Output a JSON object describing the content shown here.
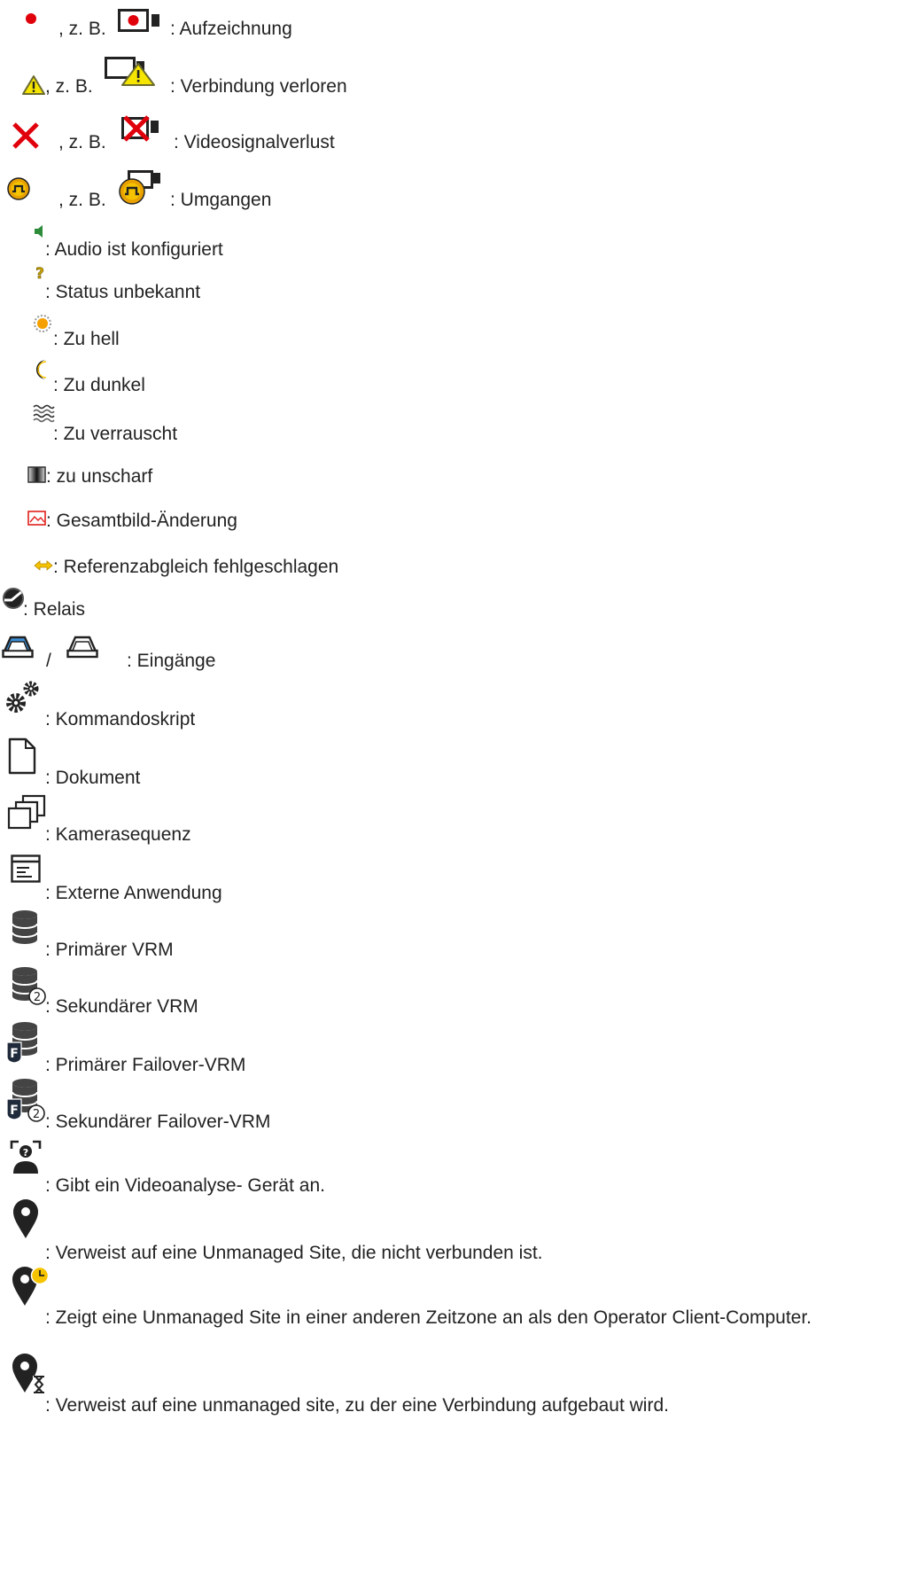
{
  "legend": {
    "eg": ", z. B.",
    "items": [
      {
        "label": ": Aufzeichnung",
        "icon": "recording-dot-icon",
        "example_icon": "camera-recording-icon"
      },
      {
        "label": ": Verbindung verloren",
        "icon": "warning-triangle-icon",
        "example_icon": "camera-connection-lost-icon"
      },
      {
        "label": ": Videosignalverlust",
        "icon": "red-x-icon",
        "example_icon": "camera-video-loss-icon"
      },
      {
        "label": ": Umgangen",
        "icon": "bypass-icon",
        "example_icon": "camera-bypassed-icon"
      },
      {
        "label": ": Audio ist konfiguriert",
        "icon": "speaker-icon"
      },
      {
        "label": ": Status unbekannt",
        "icon": "question-mark-icon"
      },
      {
        "label": ": Zu hell",
        "icon": "sun-icon"
      },
      {
        "label": ": Zu dunkel",
        "icon": "moon-icon"
      },
      {
        "label": ": Zu verrauscht",
        "icon": "noise-icon"
      },
      {
        "label": ": zu unscharf",
        "icon": "blur-icon"
      },
      {
        "label": ": Gesamtbild-Änderung",
        "icon": "scene-change-icon"
      },
      {
        "label": ": Referenzabgleich fehlgeschlagen",
        "icon": "reference-check-icon"
      },
      {
        "label": ": Relais",
        "icon": "relay-icon"
      },
      {
        "label": ": Eingänge",
        "icon": "input-active-icon",
        "separator": "/",
        "icon2": "input-inactive-icon"
      },
      {
        "label": ": Kommandoskript",
        "icon": "gears-icon"
      },
      {
        "label": ": Dokument",
        "icon": "document-icon"
      },
      {
        "label": ": Kamerasequenz",
        "icon": "camera-sequence-icon"
      },
      {
        "label": ": Externe Anwendung",
        "icon": "external-application-icon"
      },
      {
        "label": ": Primärer VRM",
        "icon": "primary-vrm-icon"
      },
      {
        "label": ": Sekundärer VRM",
        "icon": "secondary-vrm-icon"
      },
      {
        "label": ": Primärer Failover-VRM",
        "icon": "primary-failover-vrm-icon"
      },
      {
        "label": ": Sekundärer Failover-VRM",
        "icon": "secondary-failover-vrm-icon"
      },
      {
        "label": ": Gibt ein Videoanalyse- Gerät an.",
        "icon": "video-analytics-icon"
      },
      {
        "label": ": Verweist auf eine Unmanaged Site, die nicht verbunden ist.",
        "icon": "map-pin-icon"
      },
      {
        "label": ": Zeigt eine Unmanaged Site in einer anderen Zeitzone an als den Operator Client-Computer.",
        "icon": "map-pin-clock-icon"
      },
      {
        "label": ": Verweist auf eine unmanaged site, zu der eine Verbindung aufgebaut wird.",
        "icon": "map-pin-hourglass-icon"
      }
    ]
  }
}
